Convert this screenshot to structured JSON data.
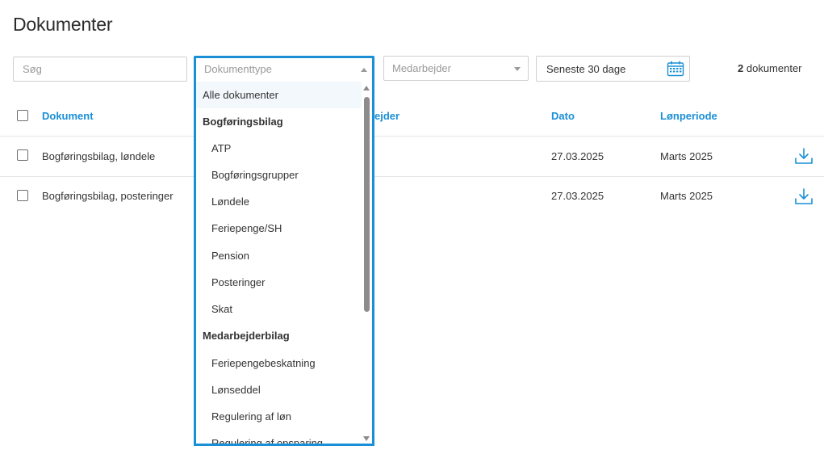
{
  "page": {
    "title": "Dokumenter"
  },
  "filters": {
    "search_placeholder": "Søg",
    "doc_type_placeholder": "Dokumenttype",
    "employee_placeholder": "Medarbejder",
    "date_range_value": "Seneste 30 dage",
    "doc_count_number": "2",
    "doc_count_label": "dokumenter"
  },
  "table": {
    "headers": {
      "document": "Dokument",
      "employee_partial": "ejder",
      "date": "Dato",
      "pay_period": "Lønperiode"
    },
    "rows": [
      {
        "document": "Bogføringsbilag, løndele",
        "date": "27.03.2025",
        "pay_period": "Marts 2025"
      },
      {
        "document": "Bogføringsbilag, posteringer",
        "date": "27.03.2025",
        "pay_period": "Marts 2025"
      }
    ]
  },
  "dropdown": {
    "all_label": "Alle dokumenter",
    "groups": [
      {
        "label": "Bogføringsbilag",
        "items": [
          "ATP",
          "Bogføringsgrupper",
          "Løndele",
          "Feriepenge/SH",
          "Pension",
          "Posteringer",
          "Skat"
        ]
      },
      {
        "label": "Medarbejderbilag",
        "items": [
          "Feriepengebeskatning",
          "Lønseddel",
          "Regulering af løn",
          "Regulering af opsparing"
        ]
      }
    ]
  },
  "colors": {
    "accent": "#1a8fd6",
    "text": "#333333",
    "border": "#cfcfcf"
  },
  "icons": {
    "date_select": "calendar-icon",
    "row_action": "download-icon"
  }
}
